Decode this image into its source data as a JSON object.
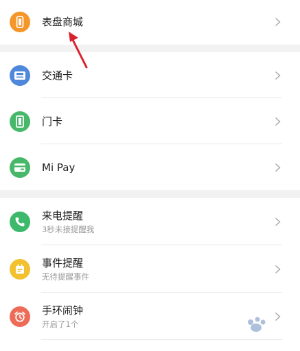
{
  "groups": [
    {
      "items": [
        {
          "title": "表盘商城",
          "subtitle": "",
          "icon": "watch-icon",
          "color": "#f5962b"
        }
      ]
    },
    {
      "items": [
        {
          "title": "交通卡",
          "subtitle": "",
          "icon": "bus-card-icon",
          "color": "#4f87db"
        },
        {
          "title": "门卡",
          "subtitle": "",
          "icon": "door-card-icon",
          "color": "#47b86a"
        },
        {
          "title": "Mi Pay",
          "subtitle": "",
          "icon": "wallet-icon",
          "color": "#47b86a"
        }
      ]
    },
    {
      "items": [
        {
          "title": "来电提醒",
          "subtitle": "3秒未接提醒我",
          "icon": "phone-icon",
          "color": "#3cb96a"
        },
        {
          "title": "事件提醒",
          "subtitle": "无待提醒事件",
          "icon": "calendar-icon",
          "color": "#f3c12f"
        },
        {
          "title": "手环闹钟",
          "subtitle": "开启了1个",
          "icon": "alarm-icon",
          "color": "#ee6b57"
        }
      ]
    }
  ],
  "annotation_color": "#d8232f"
}
